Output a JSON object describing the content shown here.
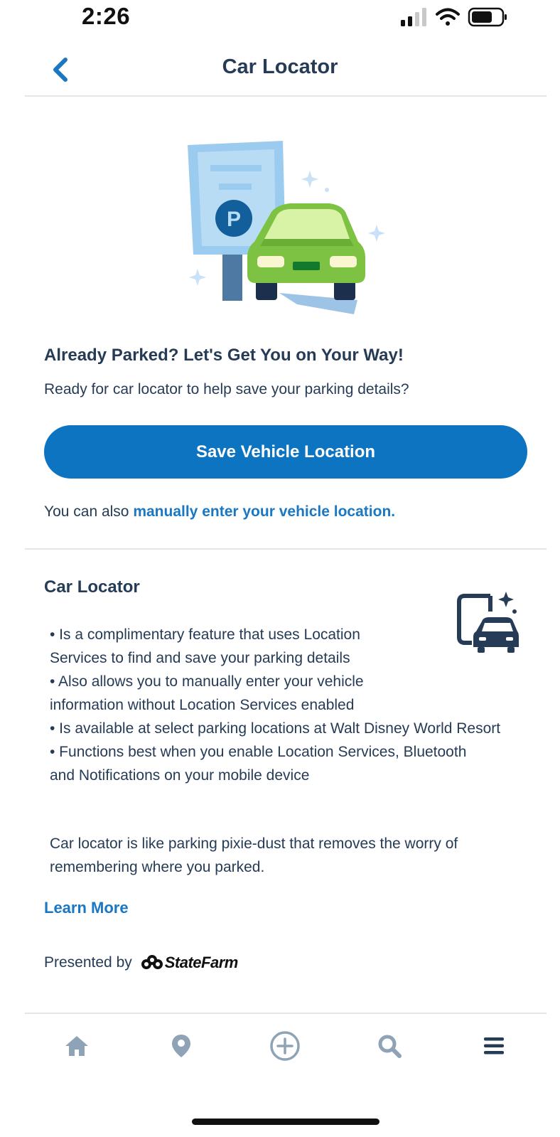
{
  "status_bar": {
    "time": "2:26"
  },
  "header": {
    "title": "Car Locator"
  },
  "hero": {
    "headline": "Already Parked? Let's Get You on Your Way!",
    "subtext": "Ready for car locator to help save your parking details?",
    "save_button_label": "Save Vehicle Location",
    "manual_prefix": "You can also ",
    "manual_link": "manually enter your vehicle location."
  },
  "info": {
    "title": "Car Locator",
    "bullets": [
      "• Is a complimentary feature that uses Location Services to find and save your parking details",
      "• Also allows you to manually enter your vehicle information without Location Services enabled",
      "• Is available at select parking locations at Walt Disney World Resort",
      "• Functions best when you enable Location Services, Bluetooth and Notifications on your mobile device"
    ],
    "pixie_text": "Car locator is like parking pixie-dust that removes the worry of remembering where you parked.",
    "learn_more": "Learn More",
    "presented_by": "Presented by",
    "sponsor": "StateFarm"
  },
  "tab_bar": {
    "items": [
      {
        "icon": "home-icon"
      },
      {
        "icon": "location-pin-icon"
      },
      {
        "icon": "plus-circle-icon"
      },
      {
        "icon": "search-icon"
      },
      {
        "icon": "menu-icon"
      }
    ]
  },
  "colors": {
    "accent": "#0c74c1",
    "link": "#1977c4",
    "text": "#253b56",
    "tab_icon": "#8fa3b6"
  }
}
